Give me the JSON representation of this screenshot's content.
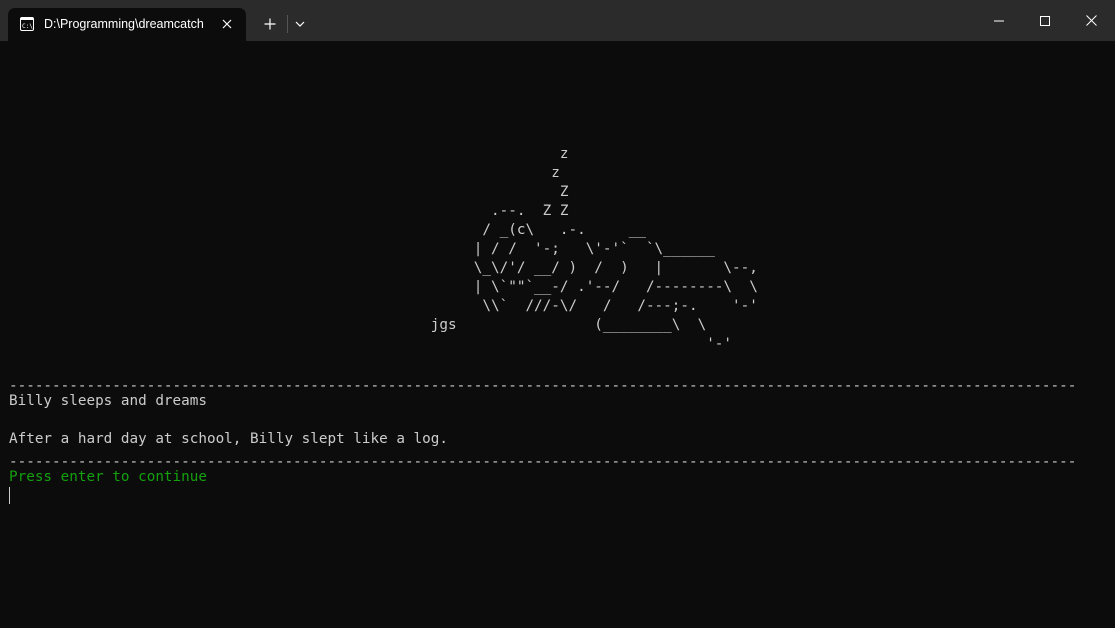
{
  "window": {
    "tab_title": "D:\\Programming\\dreamcatch",
    "tab_icon": "terminal-icon"
  },
  "terminal": {
    "art": [
      "                                                                z",
      "                                                               z",
      "                                                                Z",
      "                                                        .--.  Z Z",
      "                                                       / _(c\\   .-.     __",
      "                                                      | / /  '-;   \\'-'`  `\\______",
      "                                                      \\_\\/'/ __/ )  /  )   |       \\--,",
      "                                                      | \\`\"\"`__-/ .'--/   /--------\\  \\",
      "                                                       \\\\`  ///-\\/   /   /---;-.    '-'",
      "                                                 jgs                (________\\  \\",
      "                                                                                 '-'"
    ],
    "separator": "----------------------------------------------------------------------------------------------------------------------------",
    "scene_title": "Billy sleeps and dreams",
    "scene_text": "After a hard day at school, Billy slept like a log.",
    "prompt": "Press enter to continue"
  },
  "colors": {
    "background": "#0c0c0c",
    "foreground": "#cccccc",
    "prompt": "#13a10e",
    "titlebar": "#2b2b2b"
  }
}
